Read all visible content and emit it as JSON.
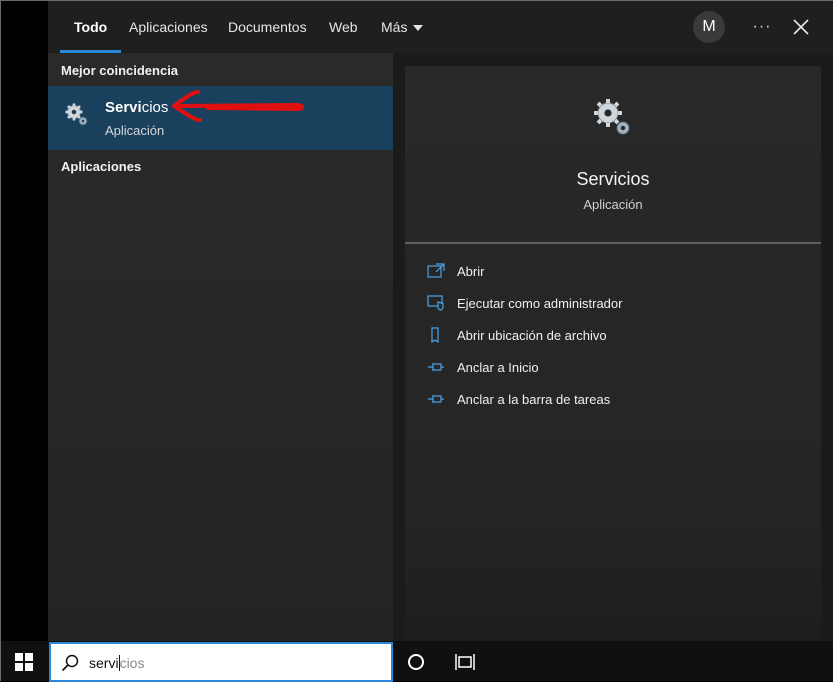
{
  "tabs": [
    {
      "label": "Todo",
      "active": true
    },
    {
      "label": "Aplicaciones",
      "active": false
    },
    {
      "label": "Documentos",
      "active": false
    },
    {
      "label": "Web",
      "active": false
    },
    {
      "label": "Más",
      "active": false
    }
  ],
  "user": {
    "avatar_initial": "M"
  },
  "toolbar": {
    "more_label": "···"
  },
  "results": {
    "best_match_header": "Mejor coincidencia",
    "best_match": {
      "title_match": "Servi",
      "title_rest": "cios",
      "subtitle": "Aplicación",
      "icon": "gears-icon"
    },
    "apps_header": "Aplicaciones"
  },
  "details": {
    "title": "Servicios",
    "subtitle": "Aplicación",
    "icon": "gears-icon",
    "actions": [
      {
        "label": "Abrir",
        "icon": "open-icon"
      },
      {
        "label": "Ejecutar como administrador",
        "icon": "run-as-admin-icon"
      },
      {
        "label": "Abrir ubicación de archivo",
        "icon": "file-location-icon"
      },
      {
        "label": "Anclar a Inicio",
        "icon": "pin-icon"
      },
      {
        "label": "Anclar a la barra de tareas",
        "icon": "pin-icon"
      }
    ]
  },
  "search": {
    "typed": "servi",
    "completion": "cios"
  },
  "colors": {
    "accent": "#2b88d8",
    "selected_bg": "#19405c",
    "annotation_arrow": "#e01010"
  }
}
